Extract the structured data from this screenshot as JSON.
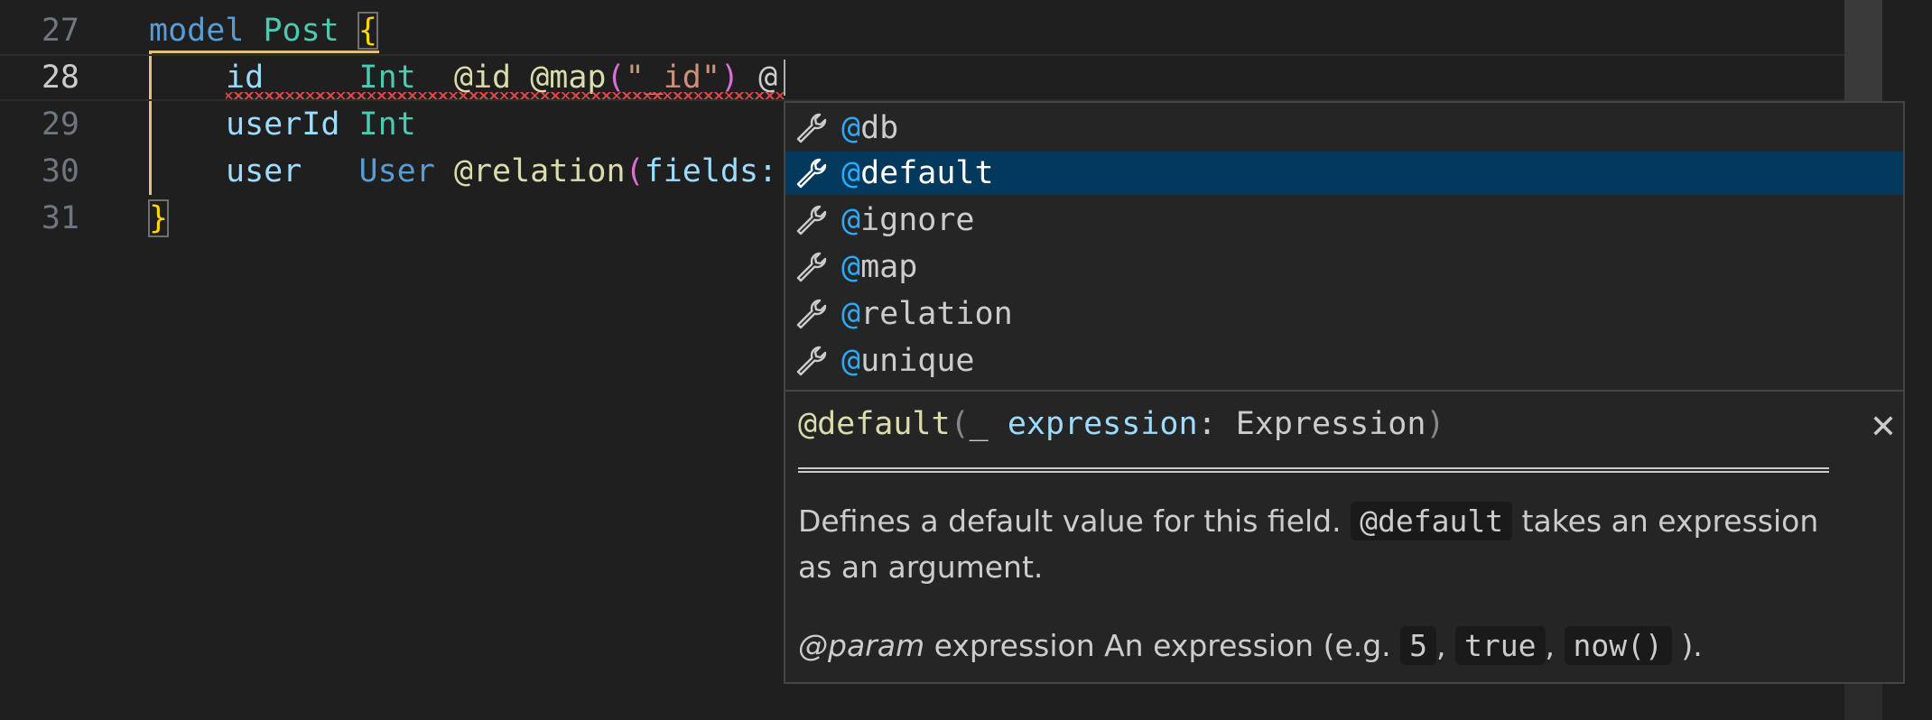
{
  "editor": {
    "lines": [
      {
        "number": "27",
        "tokens": {
          "kw": "model",
          "name": "Post",
          "brace": "{"
        }
      },
      {
        "number": "28",
        "tokens": {
          "field": "id",
          "type": "Int",
          "attr1": "@id",
          "attr2": "@map",
          "popen": "(",
          "str": "\"_id\"",
          "pclose": ")",
          "typed": "@"
        }
      },
      {
        "number": "29",
        "tokens": {
          "field": "userId",
          "type": "Int"
        }
      },
      {
        "number": "30",
        "tokens": {
          "field": "user",
          "type": "User",
          "attr": "@relation",
          "popen": "(",
          "arg": "fields:"
        }
      },
      {
        "number": "31",
        "tokens": {
          "brace": "}"
        }
      }
    ]
  },
  "suggest": {
    "match_prefix": "@",
    "items": [
      {
        "rest": "db",
        "icon": "wrench-icon"
      },
      {
        "rest": "default",
        "icon": "wrench-icon",
        "selected": true
      },
      {
        "rest": "ignore",
        "icon": "wrench-icon"
      },
      {
        "rest": "map",
        "icon": "wrench-icon"
      },
      {
        "rest": "relation",
        "icon": "wrench-icon"
      },
      {
        "rest": "unique",
        "icon": "wrench-icon"
      }
    ],
    "detail": {
      "sig_name": "@default",
      "sig_open": "(",
      "sig_underscore": "_ ",
      "sig_param": "expression",
      "sig_colon": ": ",
      "sig_type": "Expression",
      "sig_close": ")",
      "close_glyph": "✕",
      "doc1_a": "Defines a default value for this field. ",
      "doc1_code": "@default",
      "doc1_b": " takes an expression as an argument.",
      "doc2_tag": "@param",
      "doc2_a": " expression An expression (e.g. ",
      "doc2_c1": "5",
      "doc2_sep1": ", ",
      "doc2_c2": "true",
      "doc2_sep2": ", ",
      "doc2_c3": "now()",
      "doc2_b": " )."
    }
  },
  "colors": {
    "keyword": "#569cd6",
    "type": "#4ec9b0",
    "field": "#9cdcfe",
    "attribute": "#dcdcaa",
    "string": "#ce9178",
    "selection": "#04395e",
    "match_highlight": "#2aaaff",
    "error_squiggle": "#f14c4c"
  }
}
